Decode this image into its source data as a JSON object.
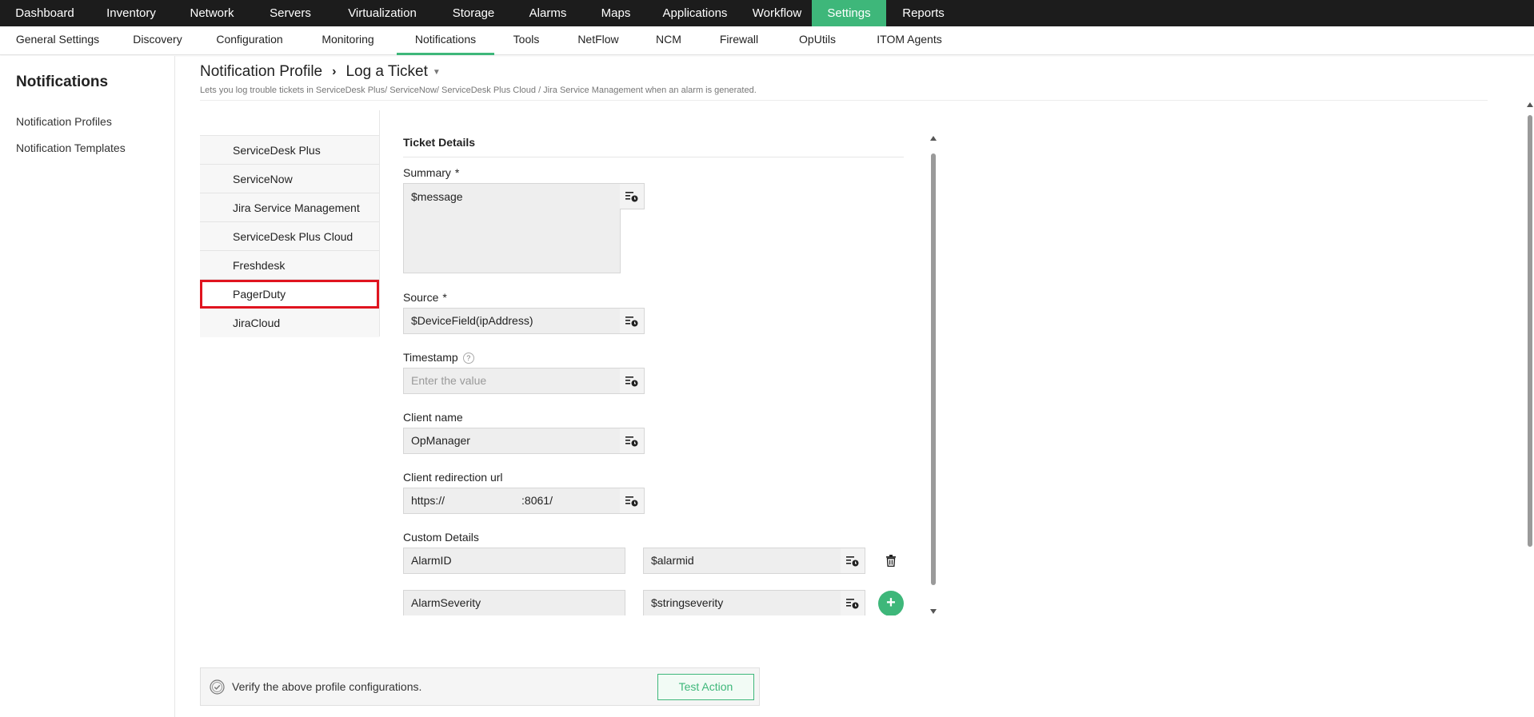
{
  "topnav": {
    "items": [
      {
        "label": "Dashboard"
      },
      {
        "label": "Inventory"
      },
      {
        "label": "Network"
      },
      {
        "label": "Servers"
      },
      {
        "label": "Virtualization"
      },
      {
        "label": "Storage"
      },
      {
        "label": "Alarms"
      },
      {
        "label": "Maps"
      },
      {
        "label": "Applications"
      },
      {
        "label": "Workflow"
      },
      {
        "label": "Settings"
      },
      {
        "label": "Reports"
      }
    ],
    "active": "Settings"
  },
  "subnav": {
    "items": [
      {
        "label": "General Settings"
      },
      {
        "label": "Discovery"
      },
      {
        "label": "Configuration"
      },
      {
        "label": "Monitoring"
      },
      {
        "label": "Notifications"
      },
      {
        "label": "Tools"
      },
      {
        "label": "NetFlow"
      },
      {
        "label": "NCM"
      },
      {
        "label": "Firewall"
      },
      {
        "label": "OpUtils"
      },
      {
        "label": "ITOM Agents"
      }
    ],
    "active": "Notifications"
  },
  "sidebar": {
    "title": "Notifications",
    "links": [
      {
        "label": "Notification Profiles"
      },
      {
        "label": "Notification Templates"
      }
    ]
  },
  "header": {
    "breadcrumb_parent": "Notification Profile",
    "breadcrumb_current": "Log a Ticket",
    "subtitle": "Lets you log trouble tickets in ServiceDesk Plus/ ServiceNow/ ServiceDesk Plus Cloud / Jira Service Management when an alarm is generated."
  },
  "tools": {
    "items": [
      {
        "label": "ServiceDesk Plus"
      },
      {
        "label": "ServiceNow"
      },
      {
        "label": "Jira Service Management"
      },
      {
        "label": "ServiceDesk Plus Cloud"
      },
      {
        "label": "Freshdesk"
      },
      {
        "label": "PagerDuty"
      },
      {
        "label": "JiraCloud"
      }
    ],
    "selected": "PagerDuty"
  },
  "form": {
    "section_title": "Ticket Details",
    "summary": {
      "label": "Summary",
      "required": "*",
      "value": "$message"
    },
    "source": {
      "label": "Source",
      "required": "*",
      "value": "$DeviceField(ipAddress)"
    },
    "timestamp": {
      "label": "Timestamp",
      "help": "?",
      "placeholder": "Enter the value"
    },
    "client_name": {
      "label": "Client name",
      "value": "OpManager"
    },
    "client_url": {
      "label": "Client redirection url",
      "value_prefix": "https://",
      "value_suffix": ":8061/"
    },
    "custom_details": {
      "label": "Custom Details",
      "rows": [
        {
          "key": "AlarmID",
          "value": "$alarmid"
        },
        {
          "key": "AlarmSeverity",
          "value": "$stringseverity"
        }
      ],
      "add_label": "+"
    }
  },
  "verify": {
    "text": "Verify the above profile configurations.",
    "button_label": "Test Action"
  },
  "colors": {
    "accent": "#3eb77a",
    "selected_outline": "#e0141f",
    "topnav_bg": "#1c1c1c"
  }
}
